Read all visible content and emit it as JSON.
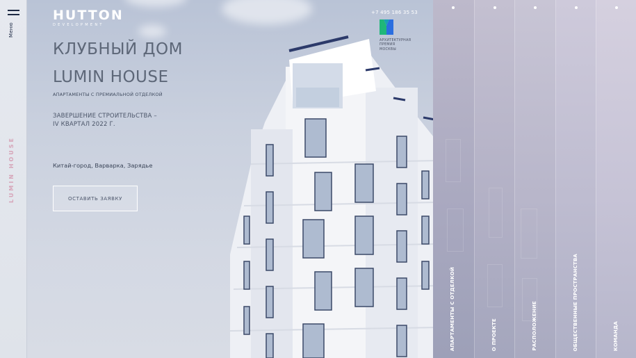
{
  "sidebar": {
    "menu_label": "Меню",
    "brand_vertical": "LUMIN HOUSE"
  },
  "header": {
    "logo_main": "HUTTON",
    "logo_sub": "DEVELOPMENT",
    "phone": "+7 495 186 35 53",
    "award_text": [
      "АРХИТЕКТУРНАЯ",
      "ПРЕМИЯ",
      "МОСКВЫ"
    ]
  },
  "hero": {
    "title_line1": "КЛУБНЫЙ ДОМ",
    "title_line2": "LUMIN HOUSE",
    "subtitle": "АПАРТАМЕНТЫ С ПРЕМИАЛЬНОЙ ОТДЕЛКОЙ",
    "completion_line1": "ЗАВЕРШЕНИЕ СТРОИТЕЛЬСТВА –",
    "completion_line2": "IV КВАРТАЛ 2022 Г.",
    "location": "Китай-город, Варварка, Зарядье",
    "cta_label": "ОСТАВИТЬ ЗАЯВКУ"
  },
  "nav": {
    "items": [
      {
        "label": "АПАРТАМЕНТЫ С ОТДЕЛКОЙ"
      },
      {
        "label": "О ПРОЕКТЕ"
      },
      {
        "label": "РАСПОЛОЖЕНИЕ"
      },
      {
        "label": "ОБЩЕСТВЕННЫЕ ПРОСТРАНСТВА"
      },
      {
        "label": "КОМАНДА"
      }
    ]
  },
  "colors": {
    "brand_accent": "#d6a4b8",
    "award_green": "#1fb77a",
    "award_blue": "#2a6ee0",
    "text_dark": "#5d6778"
  }
}
